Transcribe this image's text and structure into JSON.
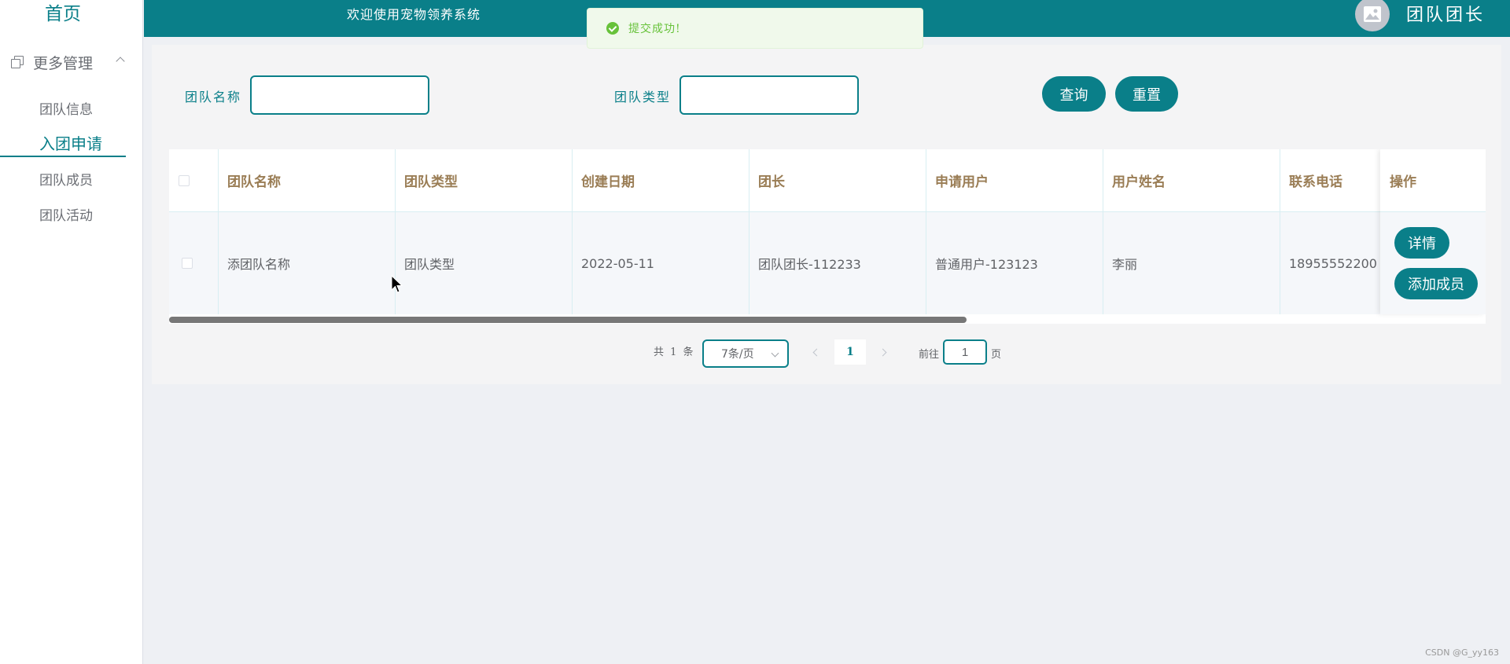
{
  "sidebar": {
    "home": "首页",
    "group_label": "更多管理",
    "items": [
      "团队信息",
      "入团申请",
      "团队成员",
      "团队活动"
    ],
    "active_index": 1
  },
  "header": {
    "title": "欢迎使用宠物领养系统",
    "user_name": "团队团长"
  },
  "toast": {
    "message": "提交成功!"
  },
  "search": {
    "name_label": "团队名称",
    "name_value": "",
    "type_label": "团队类型",
    "type_value": "",
    "query_button": "查询",
    "reset_button": "重置"
  },
  "table": {
    "columns": [
      "团队名称",
      "团队类型",
      "创建日期",
      "团长",
      "申请用户",
      "用户姓名",
      "联系电话",
      "操作"
    ],
    "rows": [
      {
        "team_name": "添团队名称",
        "team_type": "团队类型",
        "created": "2022-05-11",
        "leader": "团队团长-112233",
        "applicant": "普通用户-123123",
        "user_name": "李丽",
        "phone": "18955552200"
      }
    ],
    "detail_button": "详情",
    "add_member_button": "添加成员"
  },
  "pagination": {
    "total": "共 1 条",
    "page_size": "7条/页",
    "current_page": "1",
    "goto_prefix": "前往",
    "goto_value": "1",
    "goto_suffix": "页"
  },
  "watermark": "CSDN @G_yy163",
  "colors": {
    "primary": "#0a7f89",
    "header_text_gold": "#9a7d55",
    "success": "#67c23a"
  }
}
